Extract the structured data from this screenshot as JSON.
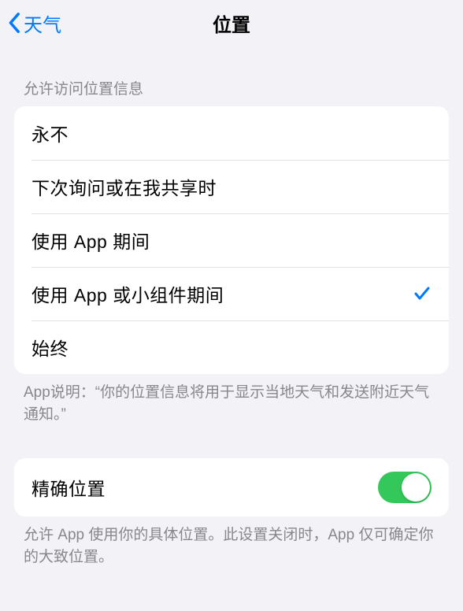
{
  "nav": {
    "back_label": "天气",
    "title": "位置"
  },
  "section1": {
    "header": "允许访问位置信息",
    "options": [
      {
        "label": "永不",
        "selected": false
      },
      {
        "label": "下次询问或在我共享时",
        "selected": false
      },
      {
        "label": "使用 App 期间",
        "selected": false
      },
      {
        "label": "使用 App 或小组件期间",
        "selected": true
      },
      {
        "label": "始终",
        "selected": false
      }
    ],
    "footer": "App说明：“你的位置信息将用于显示当地天气和发送附近天气通知。”"
  },
  "section2": {
    "toggle_label": "精确位置",
    "toggle_on": true,
    "footer": "允许 App 使用你的具体位置。此设置关闭时，App 仅可确定你的大致位置。"
  }
}
